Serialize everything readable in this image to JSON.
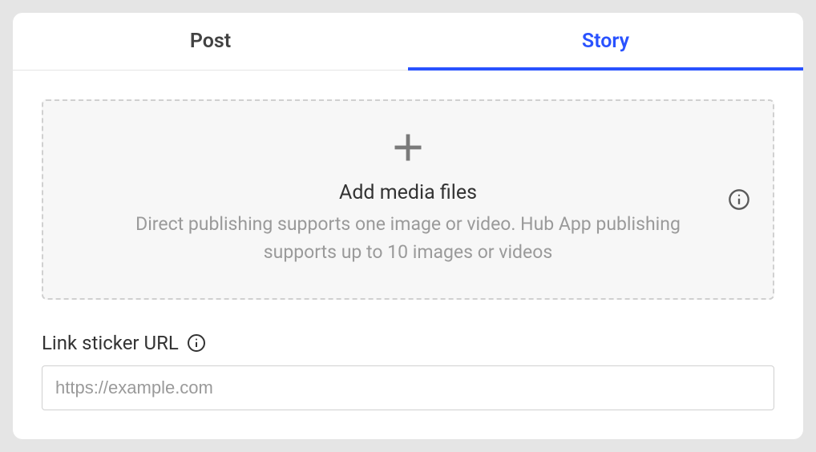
{
  "tabs": {
    "post": "Post",
    "story": "Story",
    "active": "story"
  },
  "dropzone": {
    "title": "Add media files",
    "subtitle": "Direct publishing supports one image or video. Hub App publishing supports up to 10 images or videos"
  },
  "link_sticker": {
    "label": "Link sticker URL",
    "placeholder": "https://example.com",
    "value": ""
  }
}
